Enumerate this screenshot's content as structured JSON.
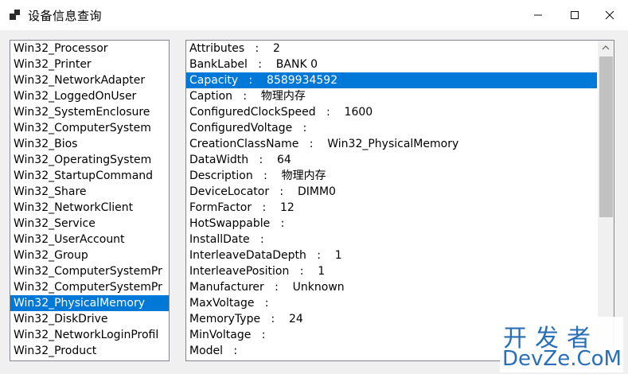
{
  "window": {
    "title": "设备信息查询",
    "controls": {
      "minimize_icon": "minimize-icon",
      "maximize_icon": "maximize-icon",
      "close_icon": "close-icon"
    }
  },
  "wmi_classes": {
    "selected_index": 16,
    "items": [
      "Win32_Processor",
      "Win32_Printer",
      "Win32_NetworkAdapter",
      "Win32_LoggedOnUser",
      "Win32_SystemEnclosure",
      "Win32_ComputerSystem",
      "Win32_Bios",
      "Win32_OperatingSystem",
      "Win32_StartupCommand",
      "Win32_Share",
      "Win32_NetworkClient",
      "Win32_Service",
      "Win32_UserAccount",
      "Win32_Group",
      "Win32_ComputerSystemPr",
      "Win32_ComputerSystemPr",
      "Win32_PhysicalMemory",
      "Win32_DiskDrive",
      "Win32_NetworkLoginProfil",
      "Win32_Product"
    ]
  },
  "properties": {
    "selected_index": 2,
    "lines": [
      "Attributes   :    2",
      "BankLabel   :    BANK 0",
      "Capacity   :    8589934592",
      "Caption   :    物理内存",
      "ConfiguredClockSpeed   :    1600",
      "ConfiguredVoltage   :",
      "CreationClassName   :    Win32_PhysicalMemory",
      "DataWidth   :    64",
      "Description   :    物理内存",
      "DeviceLocator   :    DIMM0",
      "FormFactor   :    12",
      "HotSwappable   :",
      "InstallDate   :",
      "InterleaveDataDepth   :    1",
      "InterleavePosition   :    1",
      "Manufacturer   :    Unknown",
      "MaxVoltage   :",
      "MemoryType   :    24",
      "MinVoltage   :",
      "Model   :"
    ]
  },
  "watermark": {
    "top": "开发者",
    "bottom": "DevZe.CoM"
  },
  "colors": {
    "selection": "#0078d7",
    "watermark": "#2a6fb6"
  }
}
